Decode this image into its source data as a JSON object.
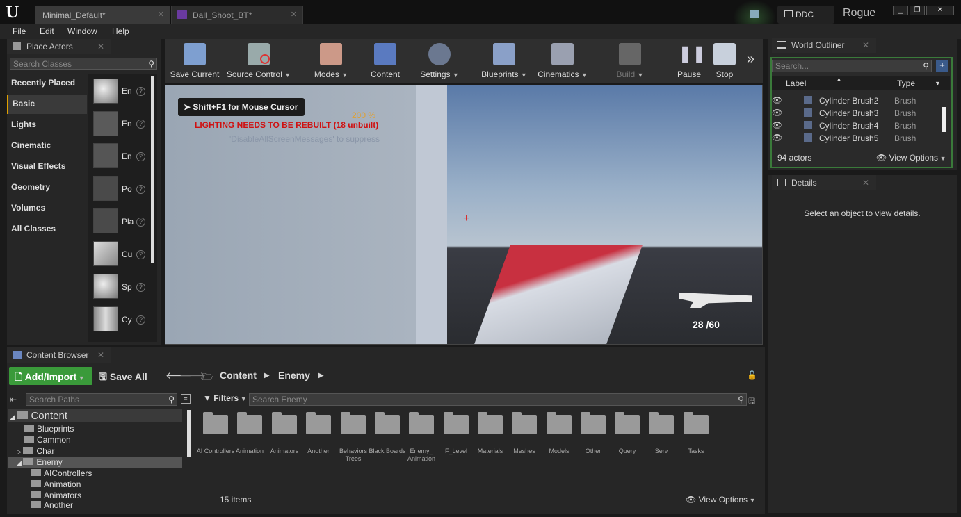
{
  "window": {
    "tabs": [
      {
        "label": "Minimal_Default*",
        "active": true
      },
      {
        "label": "Dall_Shoot_BT*",
        "active": false
      }
    ],
    "ddc": "DDC",
    "project": "Rogue"
  },
  "menu": [
    "File",
    "Edit",
    "Window",
    "Help"
  ],
  "place_actors": {
    "title": "Place Actors",
    "search_placeholder": "Search Classes",
    "categories": [
      "Recently Placed",
      "Basic",
      "Lights",
      "Cinematic",
      "Visual Effects",
      "Geometry",
      "Volumes",
      "All Classes"
    ],
    "selected": "Basic",
    "items": [
      "En",
      "En",
      "En",
      "Po",
      "Pla",
      "Cu",
      "Sp",
      "Cy"
    ]
  },
  "toolbar": {
    "buttons": [
      "Save Current",
      "Source Control",
      "Modes",
      "Content",
      "Settings",
      "Blueprints",
      "Cinematics",
      "Build",
      "Pause",
      "Stop"
    ]
  },
  "viewport": {
    "mouse_hint": "Shift+F1 for Mouse Cursor",
    "warning": "LIGHTING NEEDS TO BE REBUILT (18 unbuilt)",
    "suppress": "'DisableAllScreenMessages' to suppress",
    "hud_pct": "200 %",
    "ammo": "28 /60"
  },
  "outliner": {
    "title": "World Outliner",
    "search_placeholder": "Search...",
    "col_label": "Label",
    "col_type": "Type",
    "rows": [
      {
        "label": "Cylinder Brush2",
        "type": "Brush"
      },
      {
        "label": "Cylinder Brush3",
        "type": "Brush"
      },
      {
        "label": "Cylinder Brush4",
        "type": "Brush"
      },
      {
        "label": "Cylinder Brush5",
        "type": "Brush"
      }
    ],
    "count": "94 actors",
    "view_options": "View Options"
  },
  "details": {
    "title": "Details",
    "empty": "Select an object to view details."
  },
  "content_browser": {
    "title": "Content Browser",
    "add_import": "Add/Import",
    "save_all": "Save All",
    "path": [
      "Content",
      "Enemy"
    ],
    "search_paths_placeholder": "Search Paths",
    "filters": "Filters",
    "search_placeholder": "Search Enemy",
    "tree": [
      {
        "label": "Content",
        "level": 0
      },
      {
        "label": "Blueprints",
        "level": 1
      },
      {
        "label": "Cammon",
        "level": 1
      },
      {
        "label": "Char",
        "level": 1
      },
      {
        "label": "Enemy",
        "level": 1
      },
      {
        "label": "AIControllers",
        "level": 2
      },
      {
        "label": "Animation",
        "level": 2
      },
      {
        "label": "Animators",
        "level": 2
      },
      {
        "label": "Another",
        "level": 2
      }
    ],
    "folders": [
      "AI Controllers",
      "Animation",
      "Animators",
      "Another",
      "Behaviors Trees",
      "Black Boards",
      "Enemy_ Animation",
      "F_Level",
      "Materials",
      "Meshes",
      "Models",
      "Other",
      "Query",
      "Serv",
      "Tasks"
    ],
    "item_count": "15 items",
    "view_options": "View Options"
  }
}
